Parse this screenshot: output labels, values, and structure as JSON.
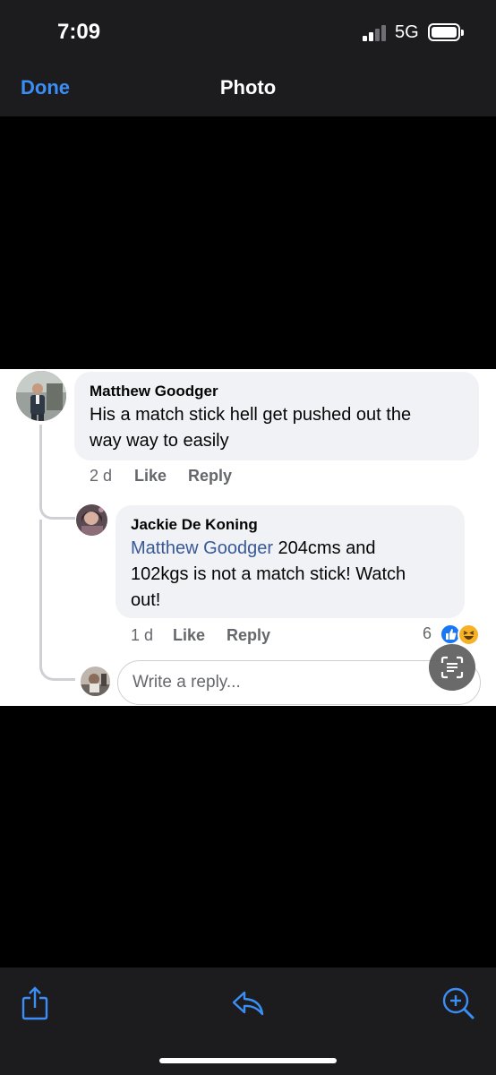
{
  "status_bar": {
    "time": "7:09",
    "network": "5G"
  },
  "nav": {
    "done_label": "Done",
    "title": "Photo"
  },
  "comment": {
    "author": "Matthew Goodger",
    "text_line1": "His a match stick hell get pushed out the",
    "text_line2": "way way to easily",
    "age": "2 d",
    "like_label": "Like",
    "reply_label": "Reply"
  },
  "reply": {
    "author": "Jackie De Koning",
    "mention": "Matthew Goodger",
    "text_line1_rest": " 204cms and",
    "text_line2": "102kgs is not a match stick! Watch",
    "text_line3": "out!",
    "age": "1 d",
    "like_label": "Like",
    "reply_label": "Reply",
    "reaction_count": "6"
  },
  "reply_input": {
    "placeholder": "Write a reply..."
  },
  "toolbar": {
    "icons": [
      "share-icon",
      "reply-arrow-icon",
      "zoom-in-icon"
    ]
  },
  "colors": {
    "accent": "#3a8ef6",
    "mention": "#385898",
    "like_blue": "#1877f2",
    "haha_yellow": "#f7b125"
  }
}
